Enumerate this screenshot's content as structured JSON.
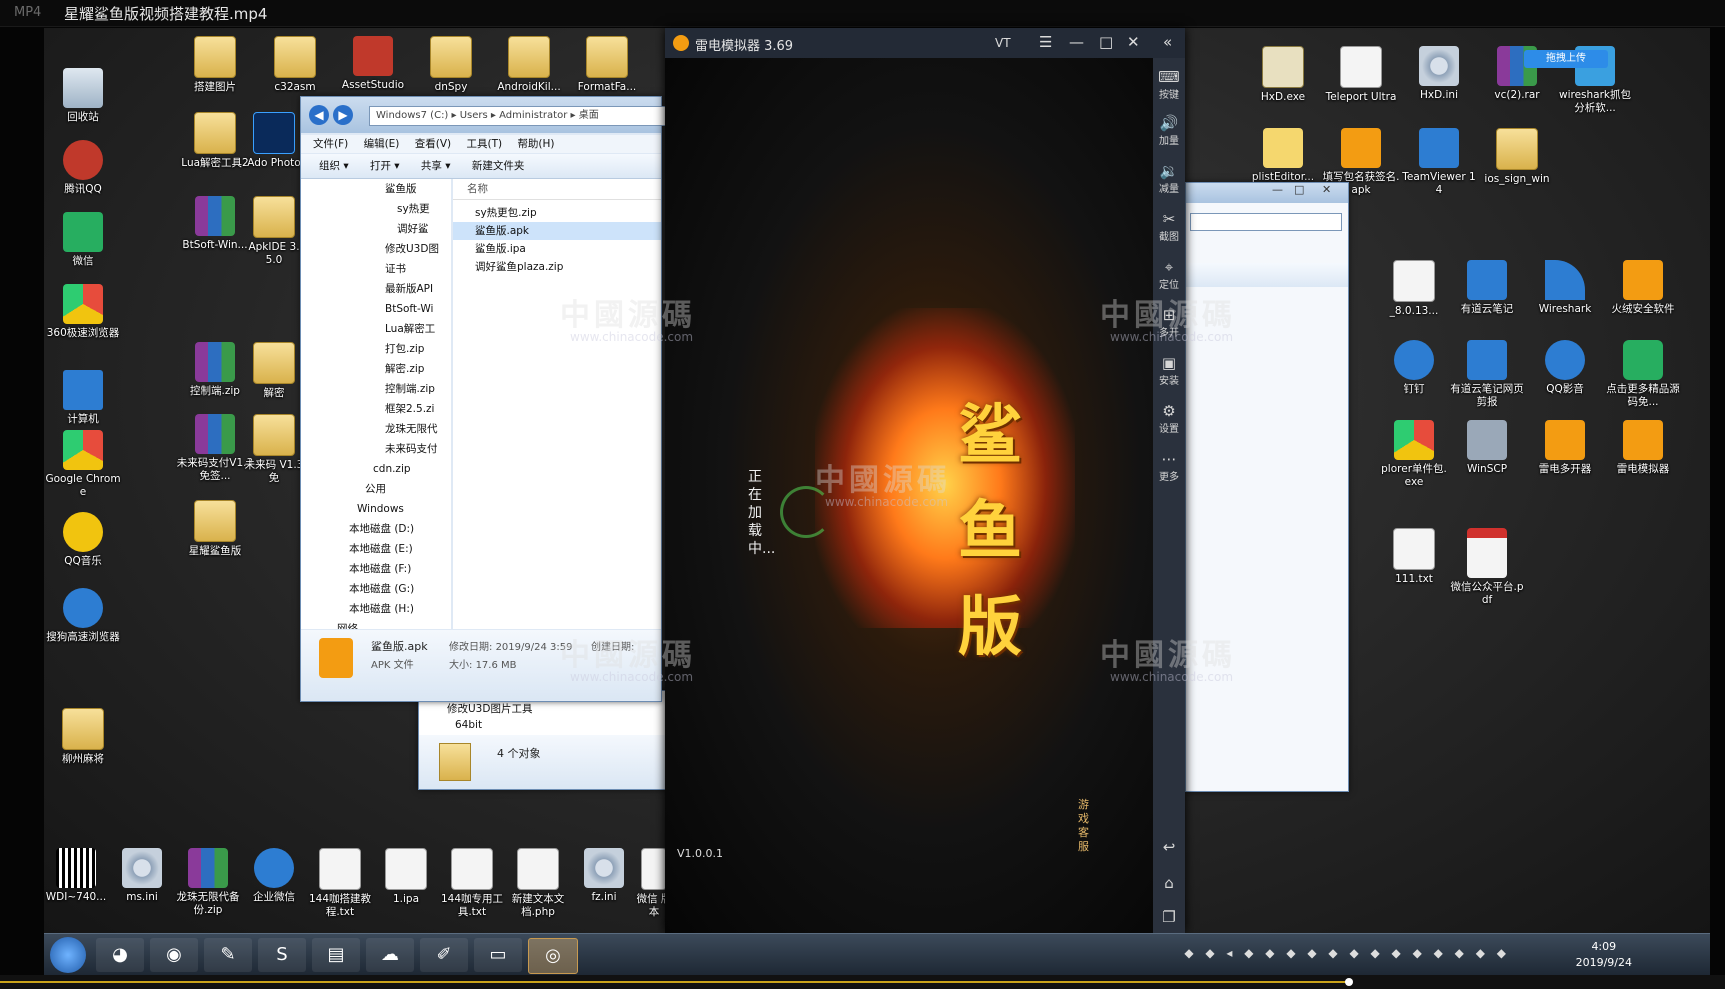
{
  "player": {
    "badge": "MP4",
    "title": "星耀鲨鱼版视频搭建教程.mp4"
  },
  "desktop_icons_left": [
    {
      "label": "回收站",
      "icon": "recycle-bin-icon"
    },
    {
      "label": "腾讯QQ",
      "icon": "qq-penguin-icon"
    },
    {
      "label": "微信",
      "icon": "wechat-icon"
    },
    {
      "label": "360极速浏览器",
      "icon": "360-browser-icon"
    },
    {
      "label": "计算机",
      "icon": "computer-icon"
    },
    {
      "label": "Google Chrome",
      "icon": "chrome-icon"
    },
    {
      "label": "QQ音乐",
      "icon": "qq-music-icon"
    },
    {
      "label": "搜狗高速浏览器",
      "icon": "sogou-browser-icon"
    },
    {
      "label": "柳州麻将",
      "icon": "folder-icon"
    }
  ],
  "desktop_icons_col2": [
    {
      "label": "搭建图片",
      "icon": "folder-icon"
    },
    {
      "label": "Lua解密工具2",
      "icon": "folder-icon"
    },
    {
      "label": "BtSoft-Win...",
      "icon": "rar-icon"
    },
    {
      "label": "控制端.zip",
      "icon": "rar-icon"
    },
    {
      "label": "未来码支付V1.3 免签...",
      "icon": "rar-icon"
    },
    {
      "label": "星耀鲨鱼版",
      "icon": "folder-icon"
    }
  ],
  "desktop_icons_top": [
    {
      "label": "c32asm",
      "icon": "folder-icon"
    },
    {
      "label": "AssetStudio",
      "icon": "assetstudio-icon"
    },
    {
      "label": "dnSpy",
      "icon": "folder-icon"
    },
    {
      "label": "AndroidKil...",
      "icon": "folder-icon"
    },
    {
      "label": "FormatFa...",
      "icon": "folder-icon"
    }
  ],
  "desktop_icons_partial": [
    {
      "label": "Ado Photo",
      "icon": "photoshop-icon"
    },
    {
      "label": "ApkIDE 3.5.0",
      "icon": "folder-icon"
    },
    {
      "label": "解密",
      "icon": "folder-icon"
    },
    {
      "label": "未来码 V1.3 免",
      "icon": "folder-icon"
    }
  ],
  "desktop_icons_right": [
    {
      "label": "HxD.exe",
      "icon": "hxd-icon"
    },
    {
      "label": "Teleport Ultra",
      "icon": "teleport-icon"
    },
    {
      "label": "HxD.ini",
      "icon": "ini-gear-icon"
    },
    {
      "label": "vc(2).rar",
      "icon": "rar-icon"
    },
    {
      "label": "wireshark抓包分析软...",
      "icon": "wireshark-folder-icon"
    },
    {
      "label": "plistEditor...",
      "icon": "plist-editor-icon"
    },
    {
      "label": "填写包名获签名.apk",
      "icon": "apk-icon"
    },
    {
      "label": "TeamViewer 14",
      "icon": "teamviewer-icon"
    },
    {
      "label": "ios_sign_win",
      "icon": "folder-icon"
    },
    {
      "label": "_8.0.13...",
      "icon": "java-icon"
    },
    {
      "label": "有道云笔记",
      "icon": "youdao-note-icon"
    },
    {
      "label": "Wireshark",
      "icon": "wireshark-icon"
    },
    {
      "label": "火绒安全软件",
      "icon": "huorong-icon"
    },
    {
      "label": "钉钉",
      "icon": "dingtalk-icon"
    },
    {
      "label": "有道云笔记网页剪报",
      "icon": "youdao-clip-icon"
    },
    {
      "label": "QQ影音",
      "icon": "qq-player-icon"
    },
    {
      "label": "点击更多精品源码免...",
      "icon": "source-code-icon"
    },
    {
      "label": "plorer单件包.exe",
      "icon": "explorer-exe-icon"
    },
    {
      "label": "WinSCP",
      "icon": "winscp-icon"
    },
    {
      "label": "雷电多开器",
      "icon": "ldmulti-icon"
    },
    {
      "label": "雷电模拟器",
      "icon": "ldplayer-icon"
    },
    {
      "label": "111.txt",
      "icon": "txt-icon"
    },
    {
      "label": "微信公众平台.pdf",
      "icon": "pdf-icon"
    }
  ],
  "desktop_icons_bottom": [
    {
      "label": "WDI~740...",
      "icon": "qr-icon"
    },
    {
      "label": "ms.ini",
      "icon": "ini-gear-icon"
    },
    {
      "label": "龙珠无限代备份.zip",
      "icon": "rar-icon"
    },
    {
      "label": "企业微信",
      "icon": "wecom-icon"
    },
    {
      "label": "144咖搭建教程.txt",
      "icon": "txt-icon"
    },
    {
      "label": "1.ipa",
      "icon": "file-icon"
    },
    {
      "label": "144咖专用工具.txt",
      "icon": "txt-icon"
    },
    {
      "label": "新建文本文档.php",
      "icon": "file-icon"
    },
    {
      "label": "fz.ini",
      "icon": "ini-gear-icon"
    },
    {
      "label": "微信 版本",
      "icon": "file-icon"
    }
  ],
  "explorer": {
    "address": [
      "Windows7 (C:)",
      "Users",
      "Administrator",
      "桌面"
    ],
    "menu": [
      "文件(F)",
      "编辑(E)",
      "查看(V)",
      "工具(T)",
      "帮助(H)"
    ],
    "toolbar": [
      "组织 ▾",
      "打开 ▾",
      "共享 ▾",
      "新建文件夹"
    ],
    "tree": [
      "鲨鱼版",
      "sy热更",
      "调好鲨",
      "修改U3D图",
      "证书",
      "最新版API",
      "BtSoft-Wi",
      "Lua解密工",
      "打包.zip",
      "解密.zip",
      "控制端.zip",
      "框架2.5.zi",
      "龙珠无限代",
      "未来码支付",
      "cdn.zip",
      "公用",
      "Windows",
      "本地磁盘 (D:)",
      "本地磁盘 (E:)",
      "本地磁盘 (F:)",
      "本地磁盘 (G:)",
      "本地磁盘 (H:)",
      "网络"
    ],
    "column_header": "名称",
    "files": [
      {
        "name": "sy热更包.zip",
        "selected": false
      },
      {
        "name": "鲨鱼版.apk",
        "selected": true
      },
      {
        "name": "鲨鱼版.ipa",
        "selected": false
      },
      {
        "name": "调好鲨鱼plaza.zip",
        "selected": false
      }
    ],
    "details": {
      "name": "鲨鱼版.apk",
      "type": "APK 文件",
      "modified_label": "修改日期:",
      "modified": "2019/9/24 3:59",
      "created_label": "创建日期:",
      "size_label": "大小:",
      "size": "17.6 MB"
    }
  },
  "explorer_back": {
    "folder": "修改U3D图片工具",
    "subitem": "64bit",
    "status": "4 个对象"
  },
  "emulator": {
    "title": "雷电模拟器 3.69",
    "vt": "VT",
    "loading": "正在加载中...",
    "version": "V1.0.0.1",
    "logo": "鲨鱼版",
    "kefu": "游戏客服",
    "sidebar": [
      {
        "label": "按键",
        "icon": "keyboard-icon"
      },
      {
        "label": "加量",
        "icon": "volume-up-icon"
      },
      {
        "label": "减量",
        "icon": "volume-down-icon"
      },
      {
        "label": "截图",
        "icon": "scissors-icon"
      },
      {
        "label": "定位",
        "icon": "location-icon"
      },
      {
        "label": "多开",
        "icon": "multi-instance-icon"
      },
      {
        "label": "安装",
        "icon": "install-icon"
      },
      {
        "label": "设置",
        "icon": "settings-gear-icon"
      },
      {
        "label": "更多",
        "icon": "more-dots-icon"
      }
    ]
  },
  "watermark": {
    "text": "中國源碼",
    "url": "www.chinacode.com"
  },
  "tooltip_upload": "拖拽上传",
  "taskbar": {
    "apps": [
      "360-browser-icon",
      "chrome-icon",
      "feishu-icon",
      "sogou-icon",
      "explorer-folder-icon",
      "baidu-netdisk-icon",
      "notepad-icon",
      "remote-desktop-icon",
      "ldplayer-icon"
    ],
    "time": "4:09",
    "date": "2019/9/24"
  },
  "playback": {
    "progress": 0.782
  }
}
